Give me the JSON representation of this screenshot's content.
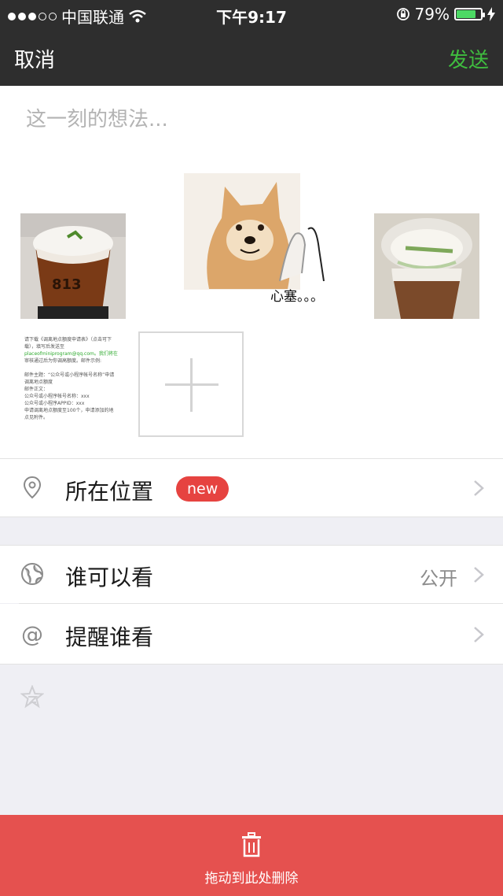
{
  "status": {
    "carrier": "中国联通",
    "time": "下午9:17",
    "battery": "79%",
    "battery_level": 0.79,
    "battery_color": "#4cd964"
  },
  "nav": {
    "cancel": "取消",
    "send": "发送",
    "send_color": "#3fbd3f"
  },
  "composer": {
    "placeholder": "这一刻的想法...",
    "sticker_caption": "心塞。。。",
    "doc_lines": [
      "请下载《调离地点额度申请表》（点击可下",
      "载），填写后发送至",
      "placeofminiprogram@qq.com。我们将在",
      "审核通过后为你调高额度。邮件示例:",
      "",
      "邮件主题：“公众号或小程序帐号名称”申请",
      "调离地点额度",
      "邮件正文：",
      "公众号或小程序帐号名称：xxx",
      "公众号或小程序APPID：xxx",
      "申请调离地点额度至100个，申请添加的地",
      "点见附件。"
    ]
  },
  "location": {
    "label": "所在位置",
    "badge": "new",
    "icon": "location-pin-icon"
  },
  "visibility": {
    "label": "谁可以看",
    "value": "公开",
    "icon": "globe-icon"
  },
  "remind": {
    "label": "提醒谁看",
    "icon": "at-icon"
  },
  "delete_zone": {
    "label": "拖动到此处删除",
    "icon": "trash-icon",
    "color": "#e5514f"
  }
}
